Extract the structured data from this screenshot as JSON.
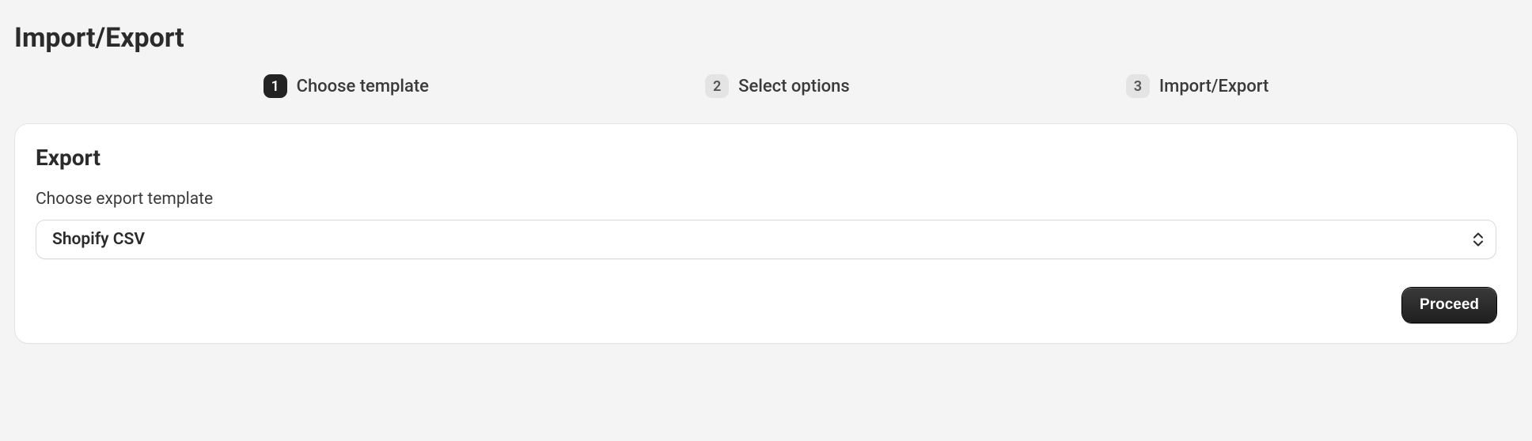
{
  "page": {
    "title": "Import/Export"
  },
  "steps": [
    {
      "number": "1",
      "label": "Choose template",
      "active": true
    },
    {
      "number": "2",
      "label": "Select options",
      "active": false
    },
    {
      "number": "3",
      "label": "Import/Export",
      "active": false
    }
  ],
  "card": {
    "title": "Export",
    "form": {
      "template_label": "Choose export template",
      "template_value": "Shopify CSV"
    },
    "actions": {
      "proceed_label": "Proceed"
    }
  }
}
